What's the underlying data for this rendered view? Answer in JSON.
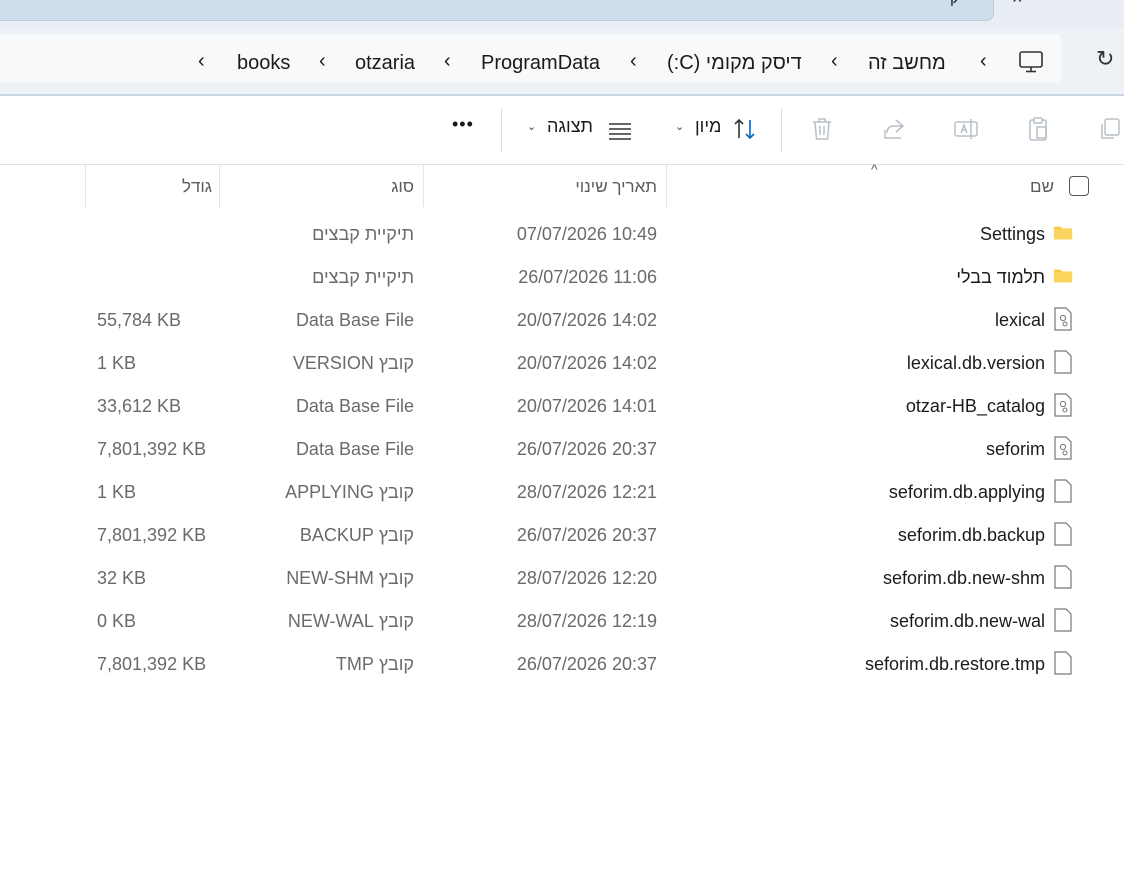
{
  "tab": {
    "label": "ק",
    "close": "×"
  },
  "breadcrumb": [
    {
      "label": "מחשב זה"
    },
    {
      "label": "דיסק מקומי (C:)"
    },
    {
      "label": "ProgramData"
    },
    {
      "label": "otzaria"
    },
    {
      "label": "books"
    }
  ],
  "toolbar": {
    "sort_label": "מיון",
    "view_label": "תצוגה",
    "more_label": "•••"
  },
  "columns": {
    "name": "שם",
    "date": "תאריך שינוי",
    "type": "סוג",
    "size": "גודל"
  },
  "files": [
    {
      "name": "Settings",
      "date": "07/07/2026 10:49",
      "type": "תיקיית קבצים",
      "size": "",
      "icon": "folder-icon"
    },
    {
      "name": "תלמוד בבלי",
      "date": "26/07/2026 11:06",
      "type": "תיקיית קבצים",
      "size": "",
      "icon": "folder-icon"
    },
    {
      "name": "lexical",
      "date": "20/07/2026 14:02",
      "type": "Data Base File",
      "size": "55,784 KB",
      "icon": "db-file-icon"
    },
    {
      "name": "lexical.db.version",
      "date": "20/07/2026 14:02",
      "type": "קובץ VERSION",
      "size": "1 KB",
      "icon": "file-icon"
    },
    {
      "name": "otzar-HB_catalog",
      "date": "20/07/2026 14:01",
      "type": "Data Base File",
      "size": "33,612 KB",
      "icon": "db-file-icon"
    },
    {
      "name": "seforim",
      "date": "26/07/2026 20:37",
      "type": "Data Base File",
      "size": "7,801,392 KB",
      "icon": "db-file-icon"
    },
    {
      "name": "seforim.db.applying",
      "date": "28/07/2026 12:21",
      "type": "קובץ APPLYING",
      "size": "1 KB",
      "icon": "file-icon"
    },
    {
      "name": "seforim.db.backup",
      "date": "26/07/2026 20:37",
      "type": "קובץ BACKUP",
      "size": "7,801,392 KB",
      "icon": "file-icon"
    },
    {
      "name": "seforim.db.new-shm",
      "date": "28/07/2026 12:20",
      "type": "קובץ NEW-SHM",
      "size": "32 KB",
      "icon": "file-icon"
    },
    {
      "name": "seforim.db.new-wal",
      "date": "28/07/2026 12:19",
      "type": "קובץ NEW-WAL",
      "size": "0 KB",
      "icon": "file-icon"
    },
    {
      "name": "seforim.db.restore.tmp",
      "date": "26/07/2026 20:37",
      "type": "קובץ TMP",
      "size": "7,801,392 KB",
      "icon": "file-icon"
    }
  ],
  "colors": {
    "folder": "#f7c948",
    "accent": "#0067c0"
  }
}
